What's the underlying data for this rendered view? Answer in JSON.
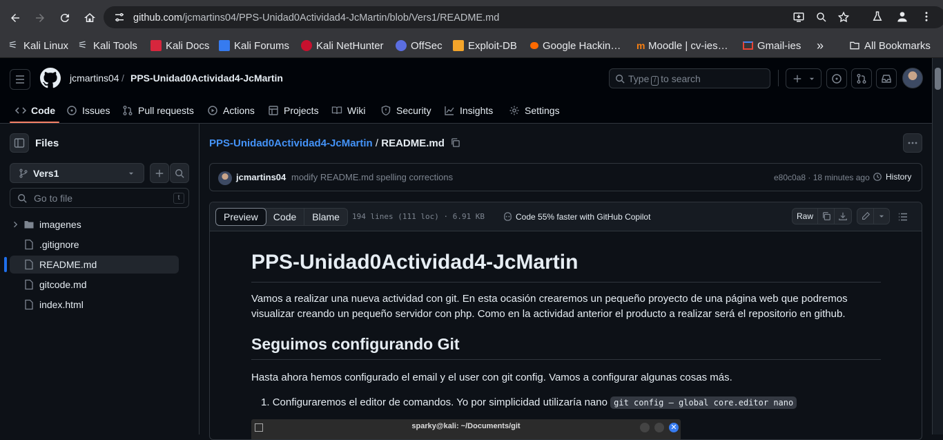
{
  "browser": {
    "url_host": "github.com",
    "url_path": "/jcmartins04/PPS-Unidad0Actividad4-JcMartin/blob/Vers1/README.md"
  },
  "bookmarks": [
    {
      "label": "Kali Linux",
      "icon": "kali-dragon-icon"
    },
    {
      "label": "Kali Tools",
      "icon": "kali-dragon-icon"
    },
    {
      "label": "Kali Docs",
      "icon": "kali-docs-icon"
    },
    {
      "label": "Kali Forums",
      "icon": "kali-forums-icon"
    },
    {
      "label": "Kali NetHunter",
      "icon": "nethunter-icon"
    },
    {
      "label": "OffSec",
      "icon": "offsec-icon"
    },
    {
      "label": "Exploit-DB",
      "icon": "exploitdb-icon"
    },
    {
      "label": "Google Hackin…",
      "icon": "ghdb-icon"
    },
    {
      "label": "Moodle | cv-ies…",
      "icon": "moodle-icon"
    },
    {
      "label": "Gmail-ies",
      "icon": "gmail-icon"
    }
  ],
  "bookmarks_all": "All Bookmarks",
  "header": {
    "owner": "jcmartins04",
    "separator": "/",
    "repo": "PPS-Unidad0Actividad4-JcMartin",
    "search_pre": "Type",
    "search_key": "/",
    "search_post": "to search"
  },
  "tabs": [
    {
      "label": "Code",
      "icon": "code-icon"
    },
    {
      "label": "Issues",
      "icon": "issue-icon"
    },
    {
      "label": "Pull requests",
      "icon": "pull-request-icon"
    },
    {
      "label": "Actions",
      "icon": "play-icon"
    },
    {
      "label": "Projects",
      "icon": "table-icon"
    },
    {
      "label": "Wiki",
      "icon": "book-icon"
    },
    {
      "label": "Security",
      "icon": "shield-icon"
    },
    {
      "label": "Insights",
      "icon": "graph-icon"
    },
    {
      "label": "Settings",
      "icon": "gear-icon"
    }
  ],
  "sidebar": {
    "title": "Files",
    "branch": "Vers1",
    "goto_placeholder": "Go to file",
    "goto_key": "t",
    "tree": [
      {
        "name": "imagenes",
        "type": "folder"
      },
      {
        "name": ".gitignore",
        "type": "file"
      },
      {
        "name": "README.md",
        "type": "file",
        "selected": true
      },
      {
        "name": "gitcode.md",
        "type": "file"
      },
      {
        "name": "index.html",
        "type": "file"
      }
    ]
  },
  "main": {
    "path_repo": "PPS-Unidad0Actividad4-JcMartin",
    "path_sep": "/",
    "path_file": "README.md",
    "commit": {
      "author": "jcmartins04",
      "message": "modify README.md spelling corrections",
      "meta": "e80c0a8 · 18 minutes ago",
      "history": "History"
    },
    "file_tabs": [
      "Preview",
      "Code",
      "Blame"
    ],
    "file_stats": "194 lines (111 loc) · 6.91 KB",
    "copilot": "Code 55% faster with GitHub Copilot",
    "raw": "Raw",
    "md": {
      "h1": "PPS-Unidad0Actividad4-JcMartin",
      "p1_line1": "Vamos a realizar una nueva actividad con git. En esta ocasión crearemos un pequeño proyecto de una página web que podremos",
      "p1_line2": "visualizar creando un pequeño servidor con php. Como en la actividad anterior el producto a realizar será el repositorio en github.",
      "h2": "Seguimos configurando Git",
      "p2": "Hasta ahora hemos configurado el email y el user con git config. Vamos a configurar algunas cosas más.",
      "li1_num": "1.",
      "li1": "Configuraremos el editor de comandos. Yo por simplicidad utilizaría nano",
      "li1_code": "git config — global core.editor nano",
      "term_title": "sparky@kali: ~/Documents/git"
    }
  },
  "colors": {
    "accent": "#4493f8",
    "tab_underline": "#f78166",
    "bg": "#0d1117"
  }
}
